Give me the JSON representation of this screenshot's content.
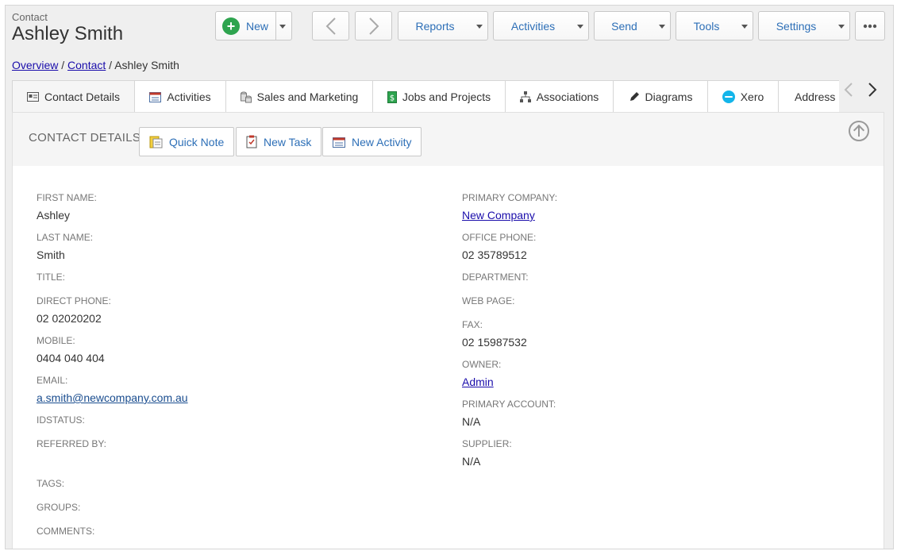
{
  "header": {
    "label": "Contact",
    "title": "Ashley Smith"
  },
  "toolbar": {
    "new_label": "New",
    "reports_label": "Reports",
    "activities_label": "Activities",
    "send_label": "Send",
    "tools_label": "Tools",
    "settings_label": "Settings"
  },
  "breadcrumb": {
    "overview": "Overview",
    "sep1": "/",
    "contact": "Contact",
    "sep2": "/",
    "current": "Ashley Smith"
  },
  "tabs": [
    {
      "label": "Contact Details",
      "icon": "card-icon"
    },
    {
      "label": "Activities",
      "icon": "calendar-icon"
    },
    {
      "label": "Sales and Marketing",
      "icon": "coins-icon"
    },
    {
      "label": "Jobs and Projects",
      "icon": "dollar-doc-icon"
    },
    {
      "label": "Associations",
      "icon": "org-chart-icon"
    },
    {
      "label": "Diagrams",
      "icon": "pencil-icon"
    },
    {
      "label": "Xero",
      "icon": "xero-icon"
    },
    {
      "label": "Address B",
      "icon": ""
    }
  ],
  "panel": {
    "title": "CONTACT DETAILS",
    "quick_note": "Quick Note",
    "new_task": "New Task",
    "new_activity": "New Activity"
  },
  "fields": {
    "first_name": {
      "label": "FIRST NAME:",
      "value": "Ashley"
    },
    "last_name": {
      "label": "LAST NAME:",
      "value": "Smith"
    },
    "title": {
      "label": "TITLE:",
      "value": ""
    },
    "direct_phone": {
      "label": "DIRECT PHONE:",
      "value": "02 02020202"
    },
    "mobile": {
      "label": "MOBILE:",
      "value": "0404 040 404"
    },
    "email": {
      "label": "EMAIL:",
      "value": "a.smith@newcompany.com.au"
    },
    "idstatus": {
      "label": "IDSTATUS:",
      "value": ""
    },
    "referred_by": {
      "label": "REFERRED BY:",
      "value": ""
    },
    "tags": {
      "label": "TAGS:",
      "value": ""
    },
    "groups": {
      "label": "GROUPS:",
      "value": ""
    },
    "comments": {
      "label": "COMMENTS:",
      "value": ""
    },
    "primary_company": {
      "label": "PRIMARY COMPANY:",
      "value": "New Company"
    },
    "office_phone": {
      "label": "OFFICE PHONE:",
      "value": "02 35789512"
    },
    "department": {
      "label": "DEPARTMENT:",
      "value": ""
    },
    "web_page": {
      "label": "WEB PAGE:",
      "value": ""
    },
    "fax": {
      "label": "FAX:",
      "value": "02 15987532"
    },
    "owner": {
      "label": "OWNER:",
      "value": "Admin"
    },
    "primary_account": {
      "label": "PRIMARY ACCOUNT:",
      "value": "N/A"
    },
    "supplier": {
      "label": "SUPPLIER:",
      "value": "N/A"
    }
  },
  "colors": {
    "accent": "#2d6fb7",
    "link": "#1a0dab",
    "new_green": "#2ea44f",
    "xero_blue": "#13b5ea"
  }
}
